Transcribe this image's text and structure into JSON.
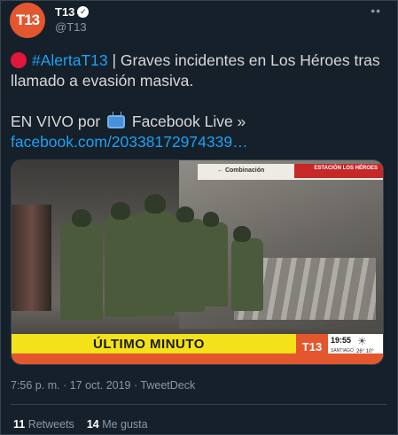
{
  "account": {
    "avatar_text": "T13",
    "display_name": "T13",
    "verified_glyph": "✓",
    "handle": "@T13",
    "more_glyph": "••"
  },
  "tweet": {
    "hashtag": "#AlertaT13",
    "text_after_hashtag": " | Graves incidentes en Los Héroes tras llamado a evasión masiva.",
    "live_prefix": "EN VIVO por ",
    "live_suffix": " Facebook Live »",
    "link": "facebook.com/20338172974339…"
  },
  "media": {
    "sign_text": "← Combinación",
    "station_text": "ESTACIÓN LOS HÉROES",
    "banner_text": "ÚLTIMO MINUTO",
    "logo_text": "T13",
    "time": "19:55",
    "city": "SANTIAGO",
    "temps": "26° 10°"
  },
  "meta": {
    "time": "7:56 p. m.",
    "sep": " · ",
    "date": "17 oct. 2019",
    "source": "TweetDeck"
  },
  "stats": {
    "retweets_count": "11",
    "retweets_label": " Retweets",
    "likes_count": "14",
    "likes_label": " Me gusta"
  },
  "colors": {
    "background": "#15202b",
    "link": "#1da1f2",
    "brand": "#e4572e",
    "banner": "#f3e21a"
  }
}
